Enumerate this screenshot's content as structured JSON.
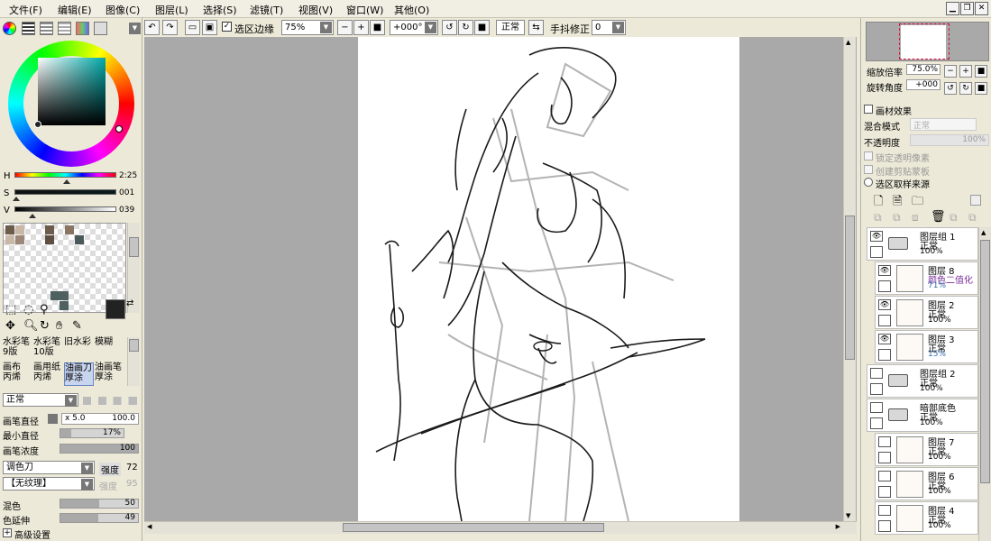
{
  "menubar": {
    "items": [
      "文件(F)",
      "编辑(E)",
      "图像(C)",
      "图层(L)",
      "选择(S)",
      "滤镜(T)",
      "视图(V)",
      "窗口(W)",
      "其他(O)"
    ]
  },
  "toolbar": {
    "selection_edge_label": "选区边缘",
    "zoom_value": "75%",
    "rotation_value": "+000°",
    "mode_label": "正常",
    "stabilizer_label": "手抖修正",
    "stabilizer_value": "0"
  },
  "color": {
    "h_label": "H",
    "h_value": "2:25",
    "s_label": "S",
    "s_value": "001",
    "v_label": "V",
    "v_value": "039",
    "hue_accent": "#00aaaa",
    "swatches": [
      "#6d5b4b",
      "#c9b7a8",
      "#6d5b4b",
      "#8a7565",
      "#c9b7a8",
      "#5e4f42",
      "#9c8778",
      "#4a5a5a"
    ]
  },
  "tools": {
    "brushes": [
      {
        "name": "水彩笔",
        "size": "9版"
      },
      {
        "name": "水彩笔",
        "size": "10版"
      },
      {
        "name": "旧水彩",
        "size": ""
      },
      {
        "name": "模糊",
        "size": ""
      },
      {
        "name": "画布",
        "size": "丙烯"
      },
      {
        "name": "画用纸",
        "size": "丙烯"
      },
      {
        "name": "油画刀",
        "size": "厚涂"
      },
      {
        "name": "油画笔",
        "size": "厚涂"
      }
    ],
    "blend_mode": "正常",
    "brush_size_label": "画笔直径",
    "brush_size_multiplier": "x 5.0",
    "brush_size_value": "100.0",
    "min_size_label": "最小直径",
    "min_size_value": "17%",
    "min_size_fraction": 0.17,
    "density_label": "画笔浓度",
    "density_value": "100",
    "density_fraction": 1.0,
    "shape_label": "调色刀",
    "strength_label": "强度",
    "strength_value": "72",
    "texture_label": "【无纹理】",
    "texture_strength_label": "强度",
    "texture_strength_value": "95",
    "blend_label": "混色",
    "blend_value": "50",
    "blend_fraction": 0.5,
    "dilution_label": "色延伸",
    "dilution_value": "49",
    "dilution_fraction": 0.49,
    "advanced_label": "高级设置"
  },
  "navigator": {
    "zoom_label": "缩放倍率",
    "zoom_value": "75.0%",
    "rotate_label": "旋转角度",
    "rotate_value": "+000"
  },
  "layer_props": {
    "texture_effect_label": "画材效果",
    "blend_mode_label": "混合模式",
    "blend_mode_value": "正常",
    "opacity_label": "不透明度",
    "opacity_value": "100%",
    "lock_alpha_label": "锁定透明像素",
    "clipping_label": "创建剪贴蒙板",
    "selection_source_label": "选区取样来源"
  },
  "layers": [
    {
      "name": "图层组 1",
      "mode": "正常",
      "opacity": "100%",
      "type": "folder",
      "indent": false,
      "visible": true
    },
    {
      "name": "图层 8",
      "mode": "颜色二值化",
      "opacity": "71%",
      "type": "layer",
      "indent": true,
      "visible": true,
      "mode_color": "#7a2f9a",
      "opa_color": "#3b6fb5"
    },
    {
      "name": "图层 2",
      "mode": "正常",
      "opacity": "100%",
      "type": "layer",
      "indent": true,
      "visible": true
    },
    {
      "name": "图层 3",
      "mode": "正常",
      "opacity": "15%",
      "type": "layer",
      "indent": true,
      "visible": true,
      "opa_color": "#3b6fb5"
    },
    {
      "name": "图层组 2",
      "mode": "正常",
      "opacity": "100%",
      "type": "folder",
      "indent": false,
      "visible": false
    },
    {
      "name": "暗部底色",
      "mode": "正常",
      "opacity": "100%",
      "type": "folder",
      "indent": false,
      "visible": false
    },
    {
      "name": "图层 7",
      "mode": "正常",
      "opacity": "100%",
      "type": "layer",
      "indent": true,
      "visible": false
    },
    {
      "name": "图层 6",
      "mode": "正常",
      "opacity": "100%",
      "type": "layer",
      "indent": true,
      "visible": false
    },
    {
      "name": "图层 4",
      "mode": "正常",
      "opacity": "100%",
      "type": "layer",
      "indent": true,
      "visible": false
    }
  ]
}
